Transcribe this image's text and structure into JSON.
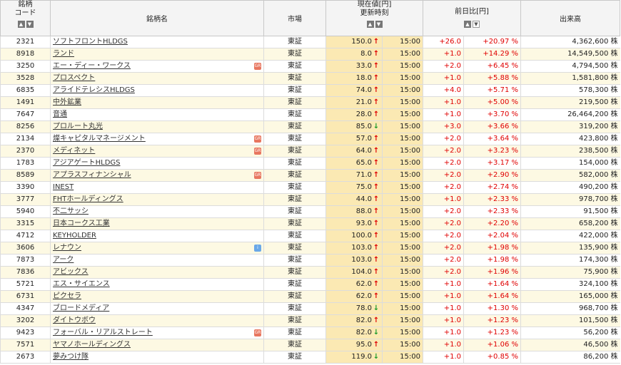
{
  "header": {
    "code_line1": "銘柄",
    "code_line2": "コード",
    "name": "銘柄名",
    "market": "市場",
    "price_line1": "現在値[円]",
    "price_line2": "更新時刻",
    "change": "前日比[円]",
    "volume": "出来高",
    "sort_up": "▲",
    "sort_down": "▼"
  },
  "rows": [
    {
      "code": "2321",
      "name": "ソフトフロントHLDGS",
      "badge": "",
      "market": "東証",
      "price": "150.0",
      "dir": "up",
      "time": "15:00",
      "chg": "+26.0",
      "pct": "+20.97 %",
      "vol": "4,362,600 株"
    },
    {
      "code": "8918",
      "name": "ランド",
      "badge": "",
      "market": "東証",
      "price": "8.0",
      "dir": "up",
      "time": "15:00",
      "chg": "+1.0",
      "pct": "+14.29 %",
      "vol": "14,549,500 株"
    },
    {
      "code": "3250",
      "name": "エー・ディー・ワークス",
      "badge": "red",
      "market": "東証",
      "price": "33.0",
      "dir": "up",
      "time": "15:00",
      "chg": "+2.0",
      "pct": "+6.45 %",
      "vol": "4,794,500 株"
    },
    {
      "code": "3528",
      "name": "プロスペクト",
      "badge": "",
      "market": "東証",
      "price": "18.0",
      "dir": "up",
      "time": "15:00",
      "chg": "+1.0",
      "pct": "+5.88 %",
      "vol": "1,581,800 株"
    },
    {
      "code": "6835",
      "name": "アライドテレシスHLDGS",
      "badge": "",
      "market": "東証",
      "price": "74.0",
      "dir": "up",
      "time": "15:00",
      "chg": "+4.0",
      "pct": "+5.71 %",
      "vol": "578,300 株"
    },
    {
      "code": "1491",
      "name": "中外鉱業",
      "badge": "",
      "market": "東証",
      "price": "21.0",
      "dir": "up",
      "time": "15:00",
      "chg": "+1.0",
      "pct": "+5.00 %",
      "vol": "219,500 株"
    },
    {
      "code": "7647",
      "name": "音通",
      "badge": "",
      "market": "東証",
      "price": "28.0",
      "dir": "up",
      "time": "15:00",
      "chg": "+1.0",
      "pct": "+3.70 %",
      "vol": "26,464,200 株"
    },
    {
      "code": "8256",
      "name": "プロルート丸光",
      "badge": "",
      "market": "東証",
      "price": "85.0",
      "dir": "down",
      "time": "15:00",
      "chg": "+3.0",
      "pct": "+3.66 %",
      "vol": "319,200 株"
    },
    {
      "code": "2134",
      "name": "燦キャピタルマネージメント",
      "badge": "red",
      "market": "東証",
      "price": "57.0",
      "dir": "up",
      "time": "15:00",
      "chg": "+2.0",
      "pct": "+3.64 %",
      "vol": "423,800 株"
    },
    {
      "code": "2370",
      "name": "メディネット",
      "badge": "red",
      "market": "東証",
      "price": "64.0",
      "dir": "up",
      "time": "15:00",
      "chg": "+2.0",
      "pct": "+3.23 %",
      "vol": "238,500 株"
    },
    {
      "code": "1783",
      "name": "アジアゲートHLDGS",
      "badge": "",
      "market": "東証",
      "price": "65.0",
      "dir": "up",
      "time": "15:00",
      "chg": "+2.0",
      "pct": "+3.17 %",
      "vol": "154,000 株"
    },
    {
      "code": "8589",
      "name": "アプラスフィナンシャル",
      "badge": "red",
      "market": "東証",
      "price": "71.0",
      "dir": "up",
      "time": "15:00",
      "chg": "+2.0",
      "pct": "+2.90 %",
      "vol": "582,000 株"
    },
    {
      "code": "3390",
      "name": "INEST",
      "badge": "",
      "market": "東証",
      "price": "75.0",
      "dir": "up",
      "time": "15:00",
      "chg": "+2.0",
      "pct": "+2.74 %",
      "vol": "490,200 株"
    },
    {
      "code": "3777",
      "name": "FHTホールディングス",
      "badge": "",
      "market": "東証",
      "price": "44.0",
      "dir": "up",
      "time": "15:00",
      "chg": "+1.0",
      "pct": "+2.33 %",
      "vol": "978,700 株"
    },
    {
      "code": "5940",
      "name": "不二サッシ",
      "badge": "",
      "market": "東証",
      "price": "88.0",
      "dir": "up",
      "time": "15:00",
      "chg": "+2.0",
      "pct": "+2.33 %",
      "vol": "91,500 株"
    },
    {
      "code": "3315",
      "name": "日本コークス工業",
      "badge": "",
      "market": "東証",
      "price": "93.0",
      "dir": "up",
      "time": "15:00",
      "chg": "+2.0",
      "pct": "+2.20 %",
      "vol": "658,200 株"
    },
    {
      "code": "4712",
      "name": "KEYHOLDER",
      "badge": "",
      "market": "東証",
      "price": "100.0",
      "dir": "up",
      "time": "15:00",
      "chg": "+2.0",
      "pct": "+2.04 %",
      "vol": "422,000 株"
    },
    {
      "code": "3606",
      "name": "レナウン",
      "badge": "blue",
      "market": "東証",
      "price": "103.0",
      "dir": "up",
      "time": "15:00",
      "chg": "+2.0",
      "pct": "+1.98 %",
      "vol": "135,900 株"
    },
    {
      "code": "7873",
      "name": "アーク",
      "badge": "",
      "market": "東証",
      "price": "103.0",
      "dir": "up",
      "time": "15:00",
      "chg": "+2.0",
      "pct": "+1.98 %",
      "vol": "174,300 株"
    },
    {
      "code": "7836",
      "name": "アビックス",
      "badge": "",
      "market": "東証",
      "price": "104.0",
      "dir": "up",
      "time": "15:00",
      "chg": "+2.0",
      "pct": "+1.96 %",
      "vol": "75,900 株"
    },
    {
      "code": "5721",
      "name": "エス・サイエンス",
      "badge": "",
      "market": "東証",
      "price": "62.0",
      "dir": "up",
      "time": "15:00",
      "chg": "+1.0",
      "pct": "+1.64 %",
      "vol": "324,100 株"
    },
    {
      "code": "6731",
      "name": "ピクセラ",
      "badge": "",
      "market": "東証",
      "price": "62.0",
      "dir": "up",
      "time": "15:00",
      "chg": "+1.0",
      "pct": "+1.64 %",
      "vol": "165,000 株"
    },
    {
      "code": "4347",
      "name": "ブロードメディア",
      "badge": "",
      "market": "東証",
      "price": "78.0",
      "dir": "down",
      "time": "15:00",
      "chg": "+1.0",
      "pct": "+1.30 %",
      "vol": "968,700 株"
    },
    {
      "code": "3202",
      "name": "ダイトウボウ",
      "badge": "",
      "market": "東証",
      "price": "82.0",
      "dir": "up",
      "time": "15:00",
      "chg": "+1.0",
      "pct": "+1.23 %",
      "vol": "101,500 株"
    },
    {
      "code": "9423",
      "name": "フォーバル・リアルストレート",
      "badge": "red",
      "market": "東証",
      "price": "82.0",
      "dir": "down",
      "time": "15:00",
      "chg": "+1.0",
      "pct": "+1.23 %",
      "vol": "56,200 株"
    },
    {
      "code": "7571",
      "name": "ヤマノホールディングス",
      "badge": "",
      "market": "東証",
      "price": "95.0",
      "dir": "up",
      "time": "15:00",
      "chg": "+1.0",
      "pct": "+1.06 %",
      "vol": "46,500 株"
    },
    {
      "code": "2673",
      "name": "夢みつけ隊",
      "badge": "",
      "market": "東証",
      "price": "119.0",
      "dir": "down",
      "time": "15:00",
      "chg": "+1.0",
      "pct": "+0.85 %",
      "vol": "86,200 株"
    }
  ]
}
